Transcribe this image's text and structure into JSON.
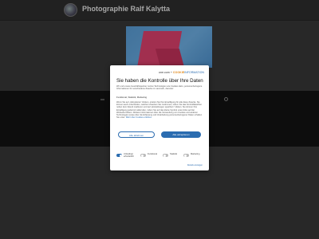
{
  "header": {
    "title": "Photographie Ralf Kalytta"
  },
  "consent": {
    "brand": {
      "one": "one.com",
      "plus": "+",
      "ci": "COOKIE",
      "ci2": "INFORMATION"
    },
    "title": "Sie haben die Kontrolle über Ihre Daten",
    "intro": "Wir und unsere Geschäftspartner nutzen Technologien wie Cookies dazu, personenbezogene Informationen für verschiedene Zwecke zu sammeln, darunter:",
    "purposes": "Funktional, Statistik, Marketing",
    "body": "Wenn Sie auf „Akzeptieren“ klicken, erteilen Sie Ihre Einwilligung für alle diese Zwecke. Sie können auch entscheiden, welchen Zwecken Sie zustimmen, indem Sie das Kontrollkästchen neben dem Zweck markieren und auf „Einstellungen speichern“ klicken. Sie können Ihre Einwilligung jederzeit widerrufen, indem Sie auf das kleine Symbol unten links auf der Webseite klicken. Weitere Informationen über die Verwendung von Cookies und anderen Technologien sowie über die Erfassung und Verarbeitung personenbezogener Daten erhalten Sie unter:",
    "link": "Mehr über Cookies erfahren",
    "reject_label": "Alle ablehnen",
    "accept_label": "Alle akzeptieren",
    "toggles": [
      {
        "label": "Unbedingt erforderlich",
        "on": true
      },
      {
        "label": "Funktional",
        "on": false
      },
      {
        "label": "Statistik",
        "on": false
      },
      {
        "label": "Marketing",
        "on": false
      }
    ],
    "details_label": "Details anzeigen"
  },
  "colors": {
    "accent": "#2b6cb0",
    "page_bg": "#383838"
  }
}
